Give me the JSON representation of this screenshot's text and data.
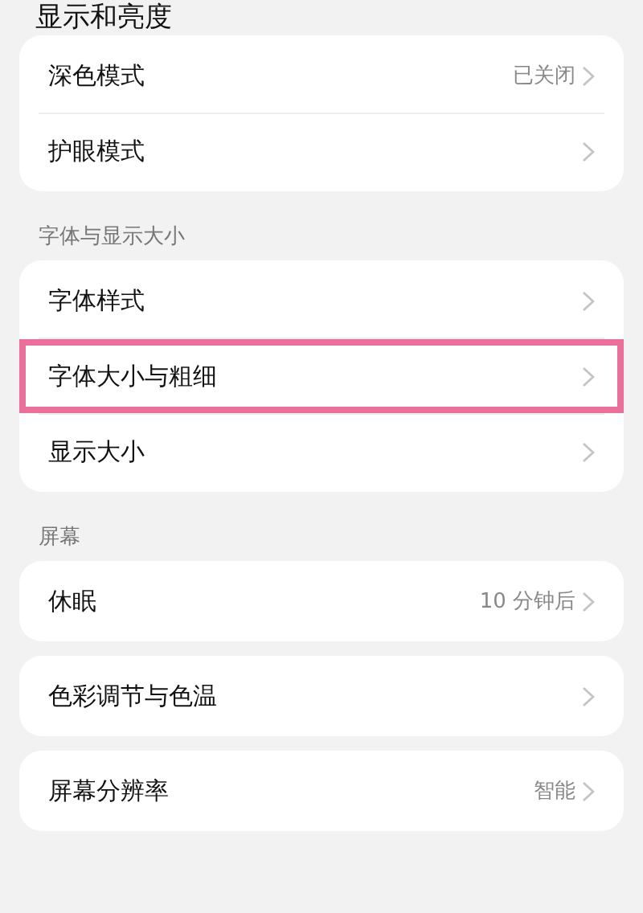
{
  "title": "显示和亮度",
  "sections": [
    {
      "cards": [
        [
          {
            "label": "深色模式",
            "value": "已关闭",
            "highlighted": false
          },
          {
            "label": "护眼模式",
            "highlighted": false
          }
        ]
      ]
    },
    {
      "header": "字体与显示大小",
      "cards": [
        [
          {
            "label": "字体样式",
            "highlighted": false
          },
          {
            "label": "字体大小与粗细",
            "highlighted": true
          },
          {
            "label": "显示大小",
            "highlighted": false
          }
        ]
      ]
    },
    {
      "header": "屏幕",
      "cards": [
        [
          {
            "label": "休眠",
            "value": "10 分钟后",
            "highlighted": false
          }
        ],
        [
          {
            "label": "色彩调节与色温",
            "highlighted": false
          }
        ],
        [
          {
            "label": "屏幕分辨率",
            "value": "智能",
            "highlighted": false
          }
        ]
      ]
    }
  ]
}
